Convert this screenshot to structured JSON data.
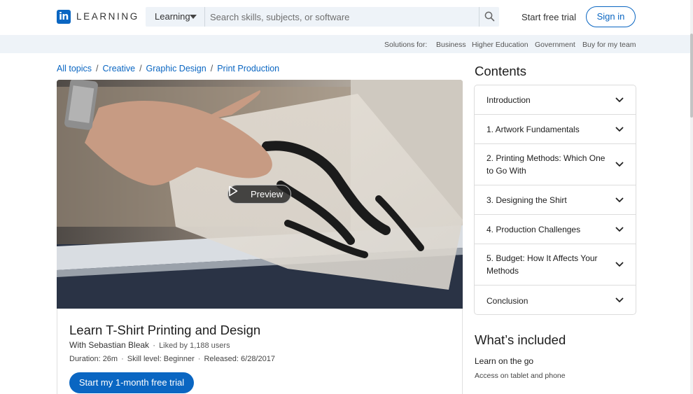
{
  "header": {
    "logo_mark": "in",
    "logo_text": "LEARNING",
    "search_select": "Learning",
    "search_placeholder": "Search skills, subjects, or software",
    "free_trial": "Start free trial",
    "sign_in": "Sign in"
  },
  "subbar": {
    "solutions_label": "Solutions for:",
    "links": [
      "Business",
      "Higher Education",
      "Government",
      "Buy for my team"
    ]
  },
  "breadcrumb": [
    "All topics",
    "Creative",
    "Graphic Design",
    "Print Production"
  ],
  "hero": {
    "preview_label": "Preview"
  },
  "course": {
    "title": "Learn T-Shirt Printing and Design",
    "author": "With Sebastian Bleak",
    "likes": "Liked by 1,188 users",
    "duration": "Duration: 26m",
    "skill": "Skill level: Beginner",
    "released": "Released: 6/28/2017",
    "cta": "Start my 1-month free trial"
  },
  "contents": {
    "title": "Contents",
    "items": [
      "Introduction",
      "1. Artwork Fundamentals",
      "2. Printing Methods: Which One to Go With",
      "3. Designing the Shirt",
      "4. Production Challenges",
      "5. Budget: How It Affects Your Methods",
      "Conclusion"
    ]
  },
  "included": {
    "title": "What’s included",
    "item_title": "Learn on the go",
    "item_desc": "Access on tablet and phone"
  },
  "colors": {
    "brand": "#0a66c2",
    "subbar_bg": "#eef3f8"
  }
}
